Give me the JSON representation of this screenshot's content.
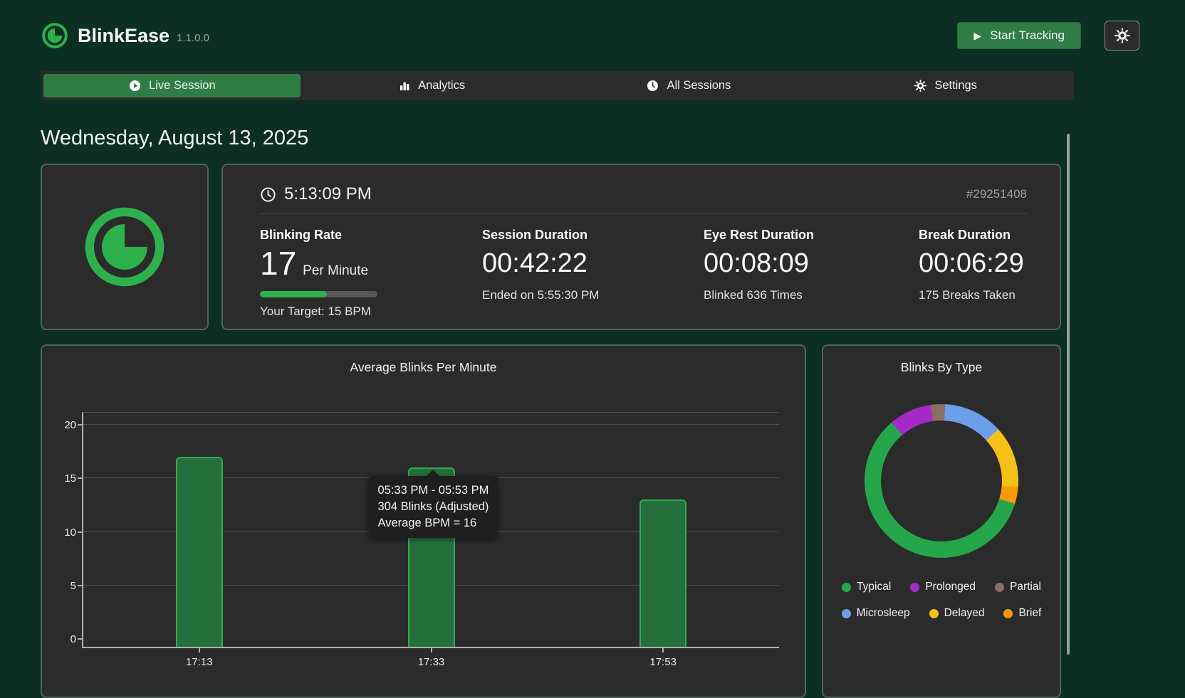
{
  "app": {
    "name": "BlinkEase",
    "version": "1.1.0.0"
  },
  "header": {
    "start_tracking_label": "Start Tracking",
    "play_glyph": "▶"
  },
  "nav": {
    "tabs": [
      {
        "label": "Live Session",
        "icon": "play-circle-icon",
        "active": true
      },
      {
        "label": "Analytics",
        "icon": "bar-chart-icon",
        "active": false
      },
      {
        "label": "All Sessions",
        "icon": "clock-icon",
        "active": false
      },
      {
        "label": "Settings",
        "icon": "gear-icon",
        "active": false
      }
    ]
  },
  "date_heading": "Wednesday, August 13, 2025",
  "session": {
    "time": "5:13:09 PM",
    "id": "#29251408",
    "stats": [
      {
        "label": "Blinking Rate",
        "value": "17",
        "unit": "Per Minute",
        "sub": "Your Target: 15 BPM",
        "progress_pct": 57
      },
      {
        "label": "Session Duration",
        "value": "00:42:22",
        "sub": "Ended on 5:55:30 PM"
      },
      {
        "label": "Eye Rest Duration",
        "value": "00:08:09",
        "sub": "Blinked 636 Times"
      },
      {
        "label": "Break Duration",
        "value": "00:06:29",
        "sub": "175 Breaks Taken"
      }
    ]
  },
  "chart_data": [
    {
      "type": "bar",
      "title": "Average Blinks Per Minute",
      "categories": [
        "17:13",
        "17:33",
        "17:53"
      ],
      "values": [
        17,
        16,
        13
      ],
      "xlabel": "",
      "ylabel": "",
      "ylim": [
        0,
        20
      ],
      "yticks": [
        0,
        5,
        10,
        15,
        20
      ],
      "grid": true,
      "tooltip": {
        "target_category": "17:33",
        "lines": [
          "05:33 PM - 05:53 PM",
          "304 Blinks (Adjusted)",
          "Average BPM = 16"
        ]
      }
    },
    {
      "type": "pie",
      "donut": true,
      "title": "Blinks By Type",
      "start_angle_deg": -8,
      "segments": [
        {
          "label": "Partial",
          "pct": 3,
          "color": "#8d6e63"
        },
        {
          "label": "Microsleep",
          "pct": 12.5,
          "color": "#6d9eea"
        },
        {
          "label": "Delayed",
          "pct": 13,
          "color": "#f5c116"
        },
        {
          "label": "Brief",
          "pct": 3.5,
          "color": "#f99b05"
        },
        {
          "label": "Typical",
          "pct": 59,
          "color": "#26a64b"
        },
        {
          "label": "Prolonged",
          "pct": 9,
          "color": "#a42bc8"
        }
      ],
      "legend_order": [
        "Typical",
        "Prolonged",
        "Partial",
        "Microsleep",
        "Delayed",
        "Brief"
      ],
      "legend_position": "bottom"
    }
  ],
  "colors": {
    "page_bg": "#0b2f23",
    "card_bg": "#2b2b2b",
    "card_border": "#4e635a",
    "accent": "#2eb14c",
    "button_green": "#2e7d46",
    "bar_fill": "#256f3d",
    "bar_border": "#2fae4e",
    "grid_line": "#4f4f4f",
    "axis": "#b0b0b0",
    "tooltip_bg": "#1f1f1f"
  }
}
